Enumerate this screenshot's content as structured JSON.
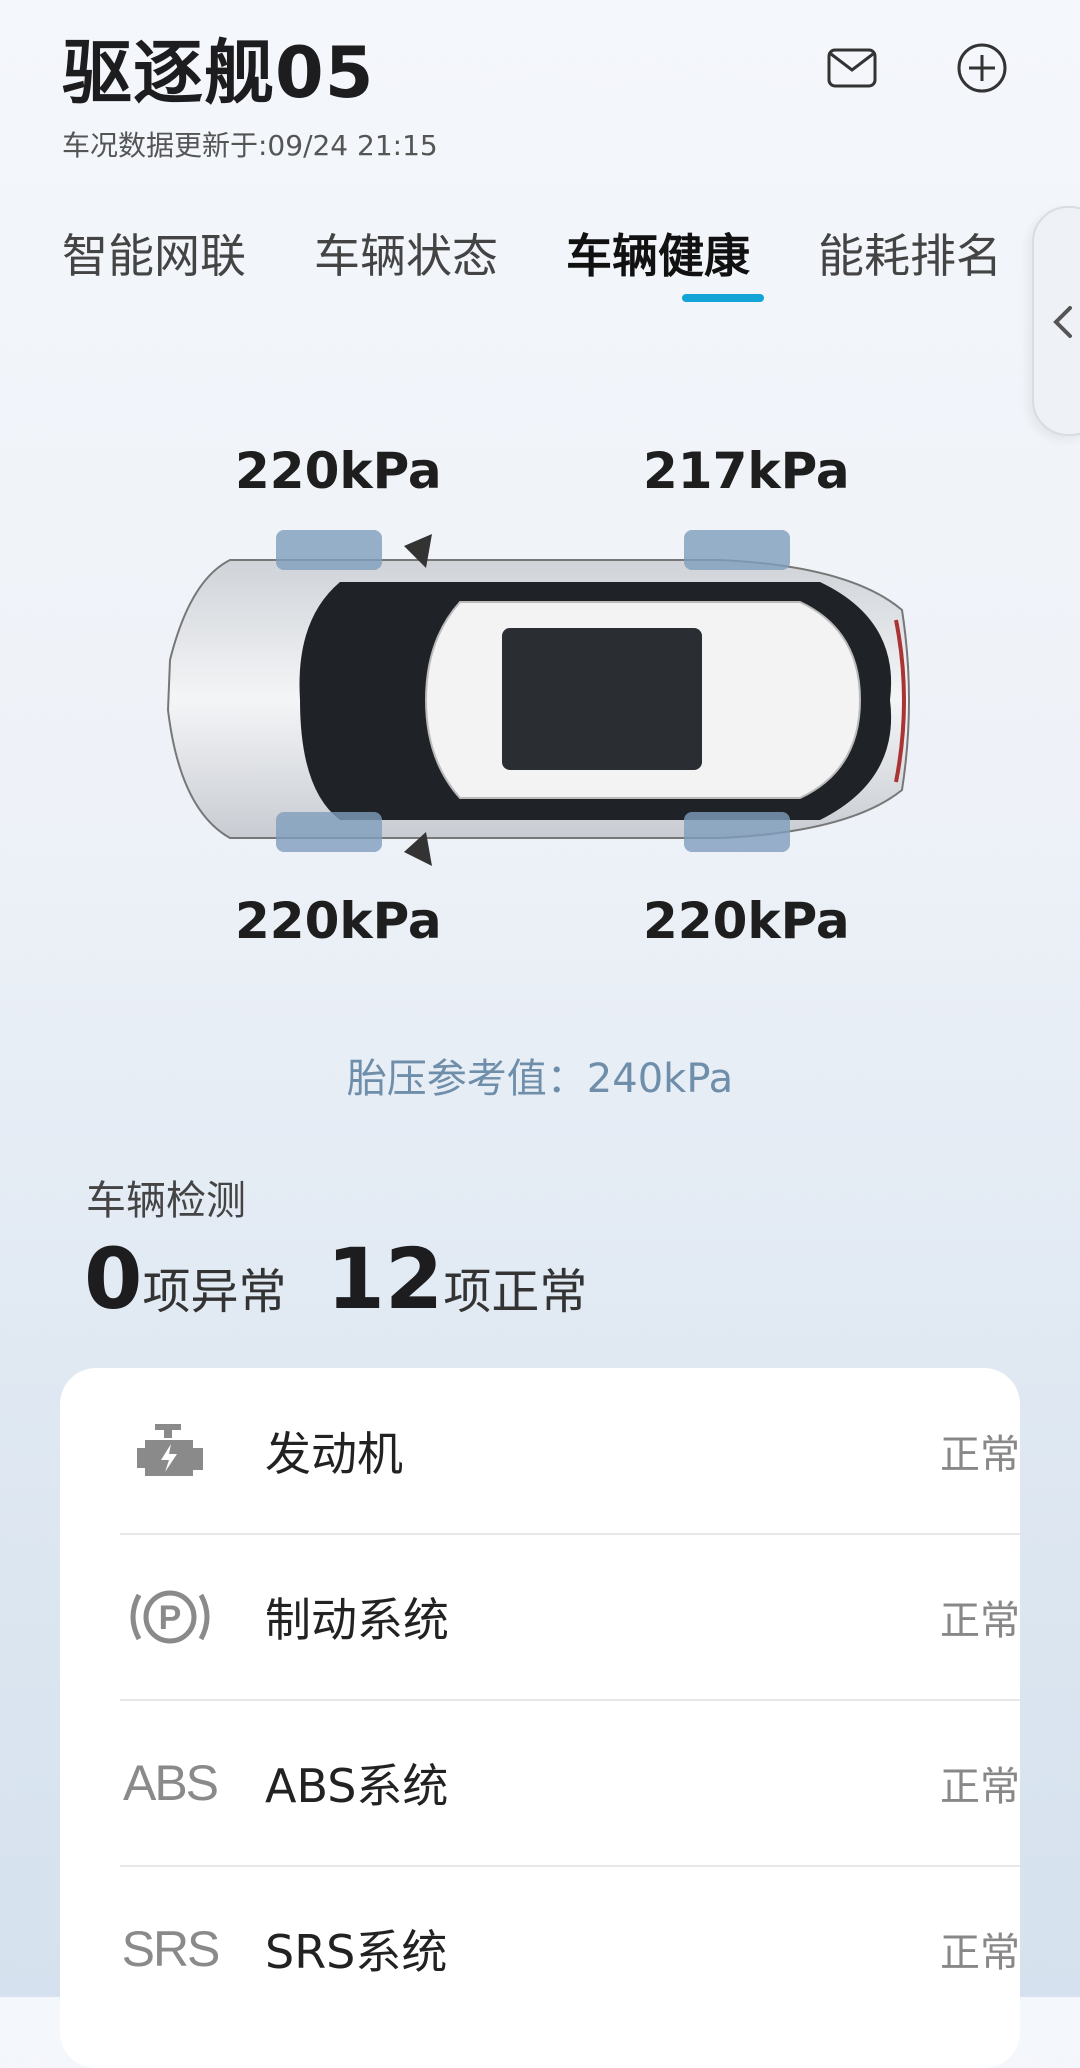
{
  "header": {
    "title": "驱逐舰05",
    "update_text": "车况数据更新于:09/24 21:15",
    "icons": [
      "mail-icon",
      "plus-circle-icon"
    ]
  },
  "tabs": [
    {
      "label": "智能网联",
      "active": false
    },
    {
      "label": "车辆状态",
      "active": false
    },
    {
      "label": "车辆健康",
      "active": true
    },
    {
      "label": "能耗排名",
      "active": false
    }
  ],
  "tire_pressure": {
    "front_left": "220kPa",
    "front_right": "217kPa",
    "rear_left": "220kPa",
    "rear_right": "220kPa",
    "reference": "胎压参考值：240kPa"
  },
  "detection": {
    "label": "车辆检测",
    "abnormal_count": "0",
    "abnormal_label": "项异常",
    "normal_count": "12",
    "normal_label": "项正常"
  },
  "items": [
    {
      "name": "发动机",
      "status": "正常",
      "icon": "engine-icon"
    },
    {
      "name": "制动系统",
      "status": "正常",
      "icon": "parking-brake-icon"
    },
    {
      "name": "ABS系统",
      "status": "正常",
      "icon": "abs-icon",
      "icon_text": "ABS"
    },
    {
      "name": "SRS系统",
      "status": "正常",
      "icon": "srs-icon",
      "icon_text": "SRS"
    }
  ],
  "colors": {
    "accent": "#12a3d7",
    "reference_text": "#6f8eaa",
    "tire_highlight": "#7f9ebd"
  }
}
